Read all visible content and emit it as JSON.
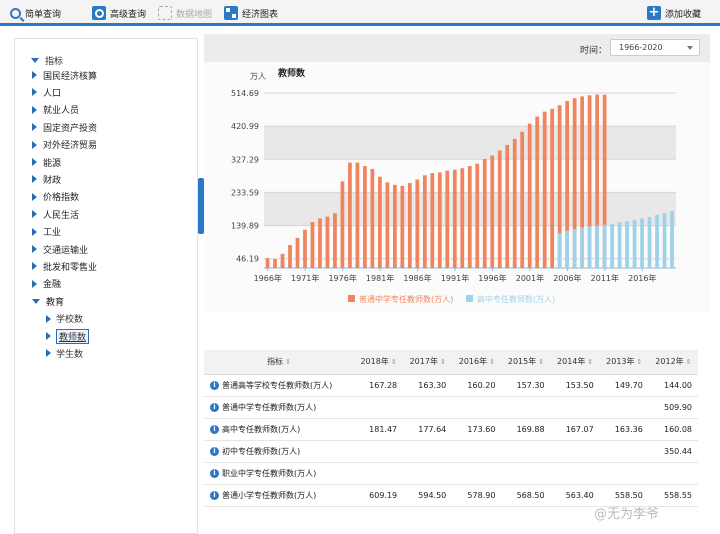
{
  "toolbar": {
    "simple_query": "简单查询",
    "advanced_query": "高级查询",
    "data_map": "数据地图",
    "econ_chart": "经济图表",
    "add_favorite": "添加收藏"
  },
  "sidebar": {
    "root_label": "指标",
    "items": [
      {
        "label": "国民经济核算"
      },
      {
        "label": "人口"
      },
      {
        "label": "就业人员"
      },
      {
        "label": "固定资产投资"
      },
      {
        "label": "对外经济贸易"
      },
      {
        "label": "能源"
      },
      {
        "label": "财政"
      },
      {
        "label": "价格指数"
      },
      {
        "label": "人民生活"
      },
      {
        "label": "工业"
      },
      {
        "label": "交通运输业"
      },
      {
        "label": "批发和零售业"
      },
      {
        "label": "金融"
      },
      {
        "label": "教育"
      }
    ],
    "sub_items": [
      {
        "label": "学校数"
      },
      {
        "label": "教师数"
      },
      {
        "label": "学生数"
      }
    ]
  },
  "filter": {
    "time_label": "时间：",
    "time_value": "1966-2020"
  },
  "colors": {
    "accent": "#2a78c8",
    "series1": "#f0845f",
    "series2": "#9fd1ea",
    "band": "#e8e8e8"
  },
  "chart_data": {
    "type": "bar",
    "title": "教师数",
    "ylabel": "万人",
    "ylim": [
      0,
      540
    ],
    "yticks": [
      "46.19",
      "139.89",
      "233.59",
      "327.29",
      "420.99",
      "514.69"
    ],
    "ytick_values": [
      46.19,
      139.89,
      233.59,
      327.29,
      420.99,
      514.69
    ],
    "xticks": [
      "1966年",
      "1971年",
      "1976年",
      "1981年",
      "1986年",
      "1991年",
      "1996年",
      "2001年",
      "2006年",
      "2011年",
      "2016年"
    ],
    "years": [
      1966,
      1967,
      1968,
      1969,
      1970,
      1971,
      1972,
      1973,
      1974,
      1975,
      1976,
      1977,
      1978,
      1979,
      1980,
      1981,
      1982,
      1983,
      1984,
      1985,
      1986,
      1987,
      1988,
      1989,
      1990,
      1991,
      1992,
      1993,
      1994,
      1995,
      1996,
      1997,
      1998,
      1999,
      2000,
      2001,
      2002,
      2003,
      2004,
      2005,
      2006,
      2007,
      2008,
      2009,
      2010,
      2011,
      2012,
      2013,
      2014,
      2015,
      2016,
      2017,
      2018,
      2019,
      2020
    ],
    "series": [
      {
        "name": "普通中学专任教师数(万人)",
        "values": [
          48,
          45,
          60,
          85,
          105,
          128,
          150,
          160,
          165,
          175,
          265,
          318,
          318,
          308,
          300,
          278,
          262,
          255,
          252,
          260,
          270,
          282,
          288,
          290,
          295,
          298,
          302,
          308,
          315,
          328,
          338,
          352,
          368,
          385,
          405,
          428,
          448,
          462,
          470,
          480,
          492,
          500,
          505,
          508,
          510,
          509.9,
          null,
          null,
          null,
          null,
          null,
          null,
          null,
          null,
          null
        ]
      },
      {
        "name": "高中专任教师数(万人)",
        "values": [
          null,
          null,
          null,
          null,
          null,
          null,
          null,
          null,
          null,
          null,
          null,
          null,
          null,
          null,
          null,
          null,
          null,
          null,
          null,
          null,
          null,
          null,
          null,
          null,
          null,
          null,
          null,
          null,
          null,
          null,
          null,
          null,
          null,
          null,
          null,
          null,
          null,
          null,
          null,
          118,
          125,
          130,
          135,
          138,
          140,
          142,
          145,
          149,
          152,
          156,
          160,
          164,
          170,
          175,
          181
        ]
      }
    ]
  },
  "table": {
    "header_label": "指标",
    "years": [
      "2018年",
      "2017年",
      "2016年",
      "2015年",
      "2014年",
      "2013年",
      "2012年"
    ],
    "rows": [
      {
        "name": "普通高等学校专任教师数(万人)",
        "values": [
          "167.28",
          "163.30",
          "160.20",
          "157.30",
          "153.50",
          "149.70",
          "144.00"
        ]
      },
      {
        "name": "普通中学专任教师数(万人)",
        "values": [
          "",
          "",
          "",
          "",
          "",
          "",
          "509.90"
        ]
      },
      {
        "name": "高中专任教师数(万人)",
        "values": [
          "181.47",
          "177.64",
          "173.60",
          "169.88",
          "167.07",
          "163.36",
          "160.08"
        ]
      },
      {
        "name": "初中专任教师数(万人)",
        "values": [
          "",
          "",
          "",
          "",
          "",
          "",
          "350.44"
        ]
      },
      {
        "name": "职业中学专任教师数(万人)",
        "values": [
          "",
          "",
          "",
          "",
          "",
          "",
          ""
        ]
      },
      {
        "name": "普通小学专任教师数(万人)",
        "values": [
          "609.19",
          "594.50",
          "578.90",
          "568.50",
          "563.40",
          "558.50",
          "558.55"
        ]
      }
    ]
  },
  "watermark": "@无为李爷"
}
